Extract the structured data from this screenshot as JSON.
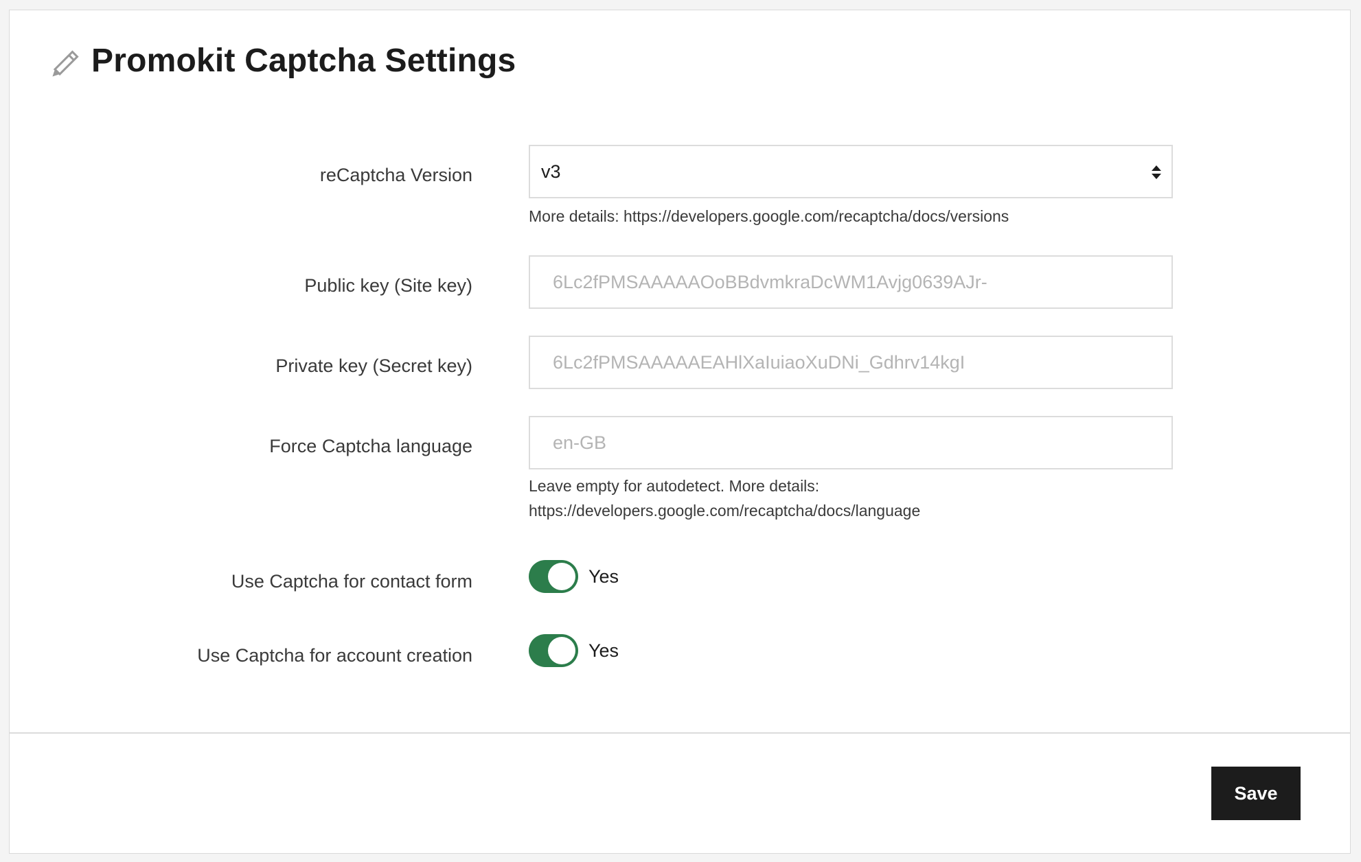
{
  "header": {
    "title": "Promokit Captcha Settings",
    "icon": "pencil-icon"
  },
  "form": {
    "recaptcha_version": {
      "label": "reCaptcha Version",
      "value": "v3",
      "help": "More details: https://developers.google.com/recaptcha/docs/versions"
    },
    "public_key": {
      "label": "Public key (Site key)",
      "placeholder": "6Lc2fPMSAAAAAOoBBdvmkraDcWM1Avjg0639AJr-"
    },
    "private_key": {
      "label": "Private key (Secret key)",
      "placeholder": "6Lc2fPMSAAAAAEAHlXaIuiaoXuDNi_Gdhrv14kgI"
    },
    "force_language": {
      "label": "Force Captcha language",
      "placeholder": "en-GB",
      "help_line1": "Leave empty for autodetect. More details:",
      "help_line2": "https://developers.google.com/recaptcha/docs/language"
    },
    "contact_form": {
      "label": "Use Captcha for contact form",
      "toggle_text": "Yes",
      "enabled": true
    },
    "account_creation": {
      "label": "Use Captcha for account creation",
      "toggle_text": "Yes",
      "enabled": true
    }
  },
  "footer": {
    "save_label": "Save"
  },
  "colors": {
    "toggle_on": "#2c7d4b",
    "button_bg": "#1c1c1c"
  }
}
